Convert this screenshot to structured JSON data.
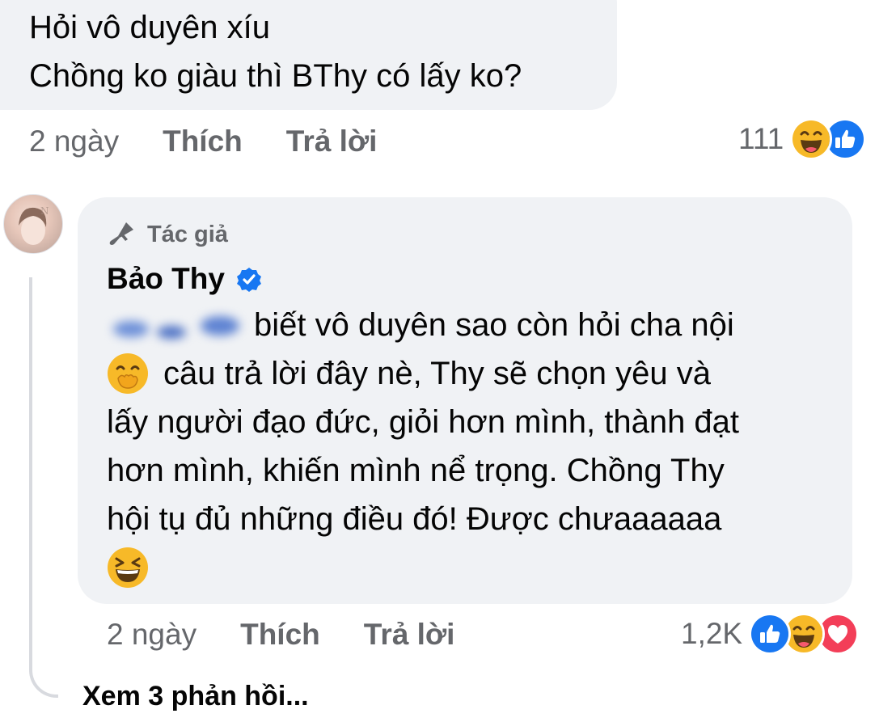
{
  "comment1": {
    "line1": "Hỏi vô duyên xíu",
    "line2": "Chồng ko giàu thì BThy có lấy ko?",
    "time": "2 ngày",
    "like_label": "Thích",
    "reply_label": "Trả lời",
    "reaction_count": "111",
    "reactions": [
      "haha-icon",
      "like-icon"
    ]
  },
  "reply": {
    "badge_label": "Tác giả",
    "author": "Bảo Thy",
    "verified": true,
    "line1": "biết vô duyên sao còn hỏi cha nội",
    "line2": "câu trả lời đây nè, Thy sẽ chọn yêu và",
    "line3": "lấy người đạo đức, giỏi hơn mình, thành đạt",
    "line4": "hơn mình, khiến mình nể trọng. Chồng Thy",
    "line5": "hội tụ đủ những điều đó! Được chưaaaaaa",
    "time": "2 ngày",
    "like_label": "Thích",
    "reply_label": "Trả lời",
    "reaction_count": "1,2K",
    "reactions": [
      "like-icon",
      "haha-icon",
      "love-icon"
    ]
  },
  "see_replies": "Xem 3 phản hồi...",
  "colors": {
    "bubble": "#f0f2f5",
    "secondary_text": "#65676b",
    "like_blue": "#1877f2",
    "haha_yellow": "#f7b928",
    "love_red": "#f33e58"
  }
}
